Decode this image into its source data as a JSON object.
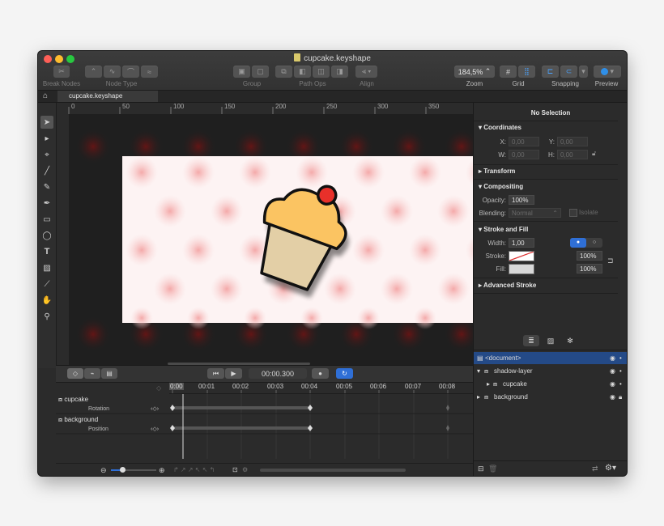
{
  "window": {
    "title": "cupcake.keyshape"
  },
  "toolbar": {
    "break_nodes": "Break Nodes",
    "node_type": "Node Type",
    "group": "Group",
    "path_ops": "Path Ops",
    "align": "Align",
    "zoom_value": "184,5%",
    "zoom_label": "Zoom",
    "grid_label": "Grid",
    "snapping_label": "Snapping",
    "preview_label": "Preview"
  },
  "tabs": [
    {
      "label": "cupcake.keyshape"
    }
  ],
  "ruler": {
    "ticks": [
      "0",
      "50",
      "100",
      "150",
      "200",
      "250",
      "300",
      "350"
    ]
  },
  "inspector": {
    "header": "No Selection",
    "coordinates": {
      "title": "Coordinates",
      "x_label": "X:",
      "x": "0,00",
      "y_label": "Y:",
      "y": "0,00",
      "w_label": "W:",
      "w": "0,00",
      "h_label": "H:",
      "h": "0,00"
    },
    "transform": {
      "title": "Transform"
    },
    "compositing": {
      "title": "Compositing",
      "opacity_label": "Opacity:",
      "opacity": "100%",
      "blending_label": "Blending:",
      "blending": "Normal",
      "isolate_label": "Isolate"
    },
    "stroke_fill": {
      "title": "Stroke and Fill",
      "width_label": "Width:",
      "width": "1,00",
      "stroke_label": "Stroke:",
      "stroke_pct": "100%",
      "fill_label": "Fill:",
      "fill_pct": "100%"
    },
    "advanced_stroke": {
      "title": "Advanced Stroke"
    }
  },
  "layers": [
    {
      "name": "<document>",
      "selected": true
    },
    {
      "name": "shadow-layer"
    },
    {
      "name": "cupcake"
    },
    {
      "name": "background"
    }
  ],
  "timeline": {
    "time": "00:00.300",
    "ticks": [
      "0:00",
      "00:01",
      "00:02",
      "00:03",
      "00:04",
      "00:05",
      "00:06",
      "00:07",
      "00:08"
    ],
    "tracks": [
      {
        "name": "cupcake",
        "property": "Rotation"
      },
      {
        "name": "background",
        "property": "Position"
      }
    ]
  },
  "colors": {
    "accent": "#2f6fd6",
    "cherry": "#e8302a",
    "frosting": "#fbc462",
    "wrapper": "#e3cfa6",
    "checker_pink": "#f6b8b8"
  }
}
